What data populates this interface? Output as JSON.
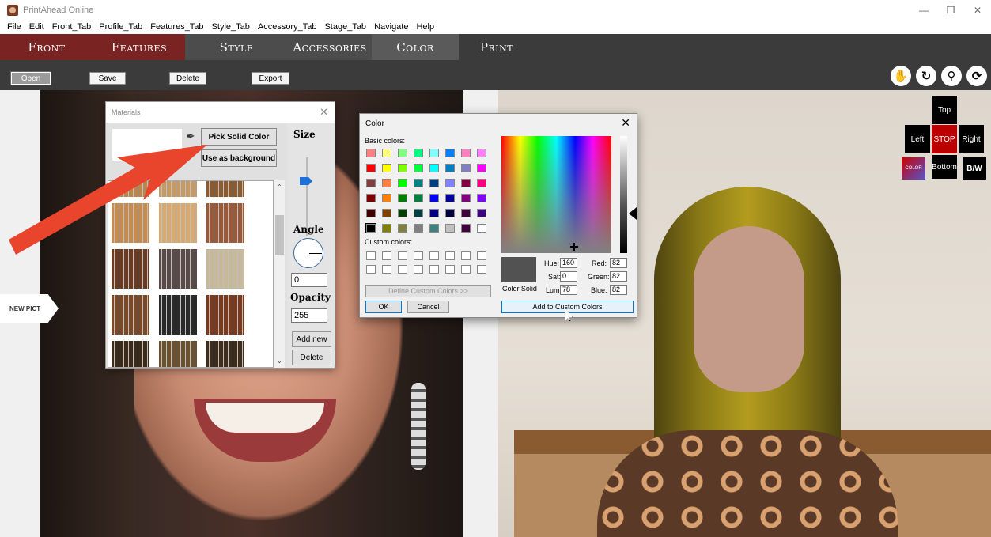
{
  "window": {
    "title": "PrintAhead Online",
    "controls": [
      "—",
      "❐",
      "✕"
    ]
  },
  "menu": [
    "File",
    "Edit",
    "Front_Tab",
    "Profile_Tab",
    "Features_Tab",
    "Style_Tab",
    "Accessory_Tab",
    "Stage_Tab",
    "Navigate",
    "Help"
  ],
  "tabs": [
    "Front",
    "Features",
    "Style",
    "Accessories",
    "Color",
    "Print"
  ],
  "toolbar": {
    "open": "Open",
    "save": "Save",
    "delete": "Delete",
    "export": "Export"
  },
  "nav_icons": [
    "hand-icon",
    "rotate-icon",
    "zoom-icon",
    "fit-icon"
  ],
  "left_panel": {
    "new_pict": "NEW PICT"
  },
  "view_controls": {
    "top": "Top",
    "left": "Left",
    "stop": "STOP",
    "right": "Right",
    "color": "COLOR",
    "bottom": "Bottom",
    "bw": "B/W"
  },
  "materials": {
    "title": "Materials",
    "pick_solid_color": "Pick Solid Color",
    "use_as_background": "Use as background",
    "size_label": "Size",
    "angle_label": "Angle",
    "angle_value": "0",
    "opacity_label": "Opacity",
    "opacity_value": "255",
    "add_new": "Add new",
    "delete": "Delete",
    "texture_colors": [
      [
        "#b8874f",
        "#c49a66",
        "#8a5a30"
      ],
      [
        "#c58c52",
        "#d7aa72",
        "#9a5a3a"
      ],
      [
        "#6b3a22",
        "#5a4a48",
        "#c8b89a"
      ],
      [
        "#7a4a28",
        "#2a2a2a",
        "#7a3a1e"
      ],
      [
        "#3a2a1a",
        "#6a5230",
        "#3e2c1c"
      ]
    ]
  },
  "color_dialog": {
    "title": "Color",
    "basic_colors_label": "Basic colors:",
    "custom_colors_label": "Custom colors:",
    "define_custom": "Define Custom Colors >>",
    "ok": "OK",
    "cancel": "Cancel",
    "color_solid": "Color|Solid",
    "add_to_custom": "Add to Custom Colors",
    "hue_label": "Hue:",
    "hue": "160",
    "sat_label": "Sat:",
    "sat": "0",
    "lum_label": "Lum:",
    "lum": "78",
    "red_label": "Red:",
    "red": "82",
    "green_label": "Green:",
    "green": "82",
    "blue_label": "Blue:",
    "blue": "82",
    "basic_colors": [
      [
        "#ff8080",
        "#ffff80",
        "#80ff80",
        "#00ff80",
        "#80ffff",
        "#0080ff",
        "#ff80c0",
        "#ff80ff"
      ],
      [
        "#ff0000",
        "#ffff00",
        "#80ff00",
        "#00ff40",
        "#00ffff",
        "#0080c0",
        "#8080c0",
        "#ff00ff"
      ],
      [
        "#804040",
        "#ff8040",
        "#00ff00",
        "#008080",
        "#004080",
        "#8080ff",
        "#800040",
        "#ff0080"
      ],
      [
        "#800000",
        "#ff8000",
        "#008000",
        "#008040",
        "#0000ff",
        "#0000a0",
        "#800080",
        "#8000ff"
      ],
      [
        "#400000",
        "#804000",
        "#004000",
        "#004040",
        "#000080",
        "#000040",
        "#400040",
        "#400080"
      ],
      [
        "#000000",
        "#808000",
        "#808040",
        "#808080",
        "#408080",
        "#c0c0c0",
        "#400040",
        "#ffffff"
      ]
    ]
  }
}
